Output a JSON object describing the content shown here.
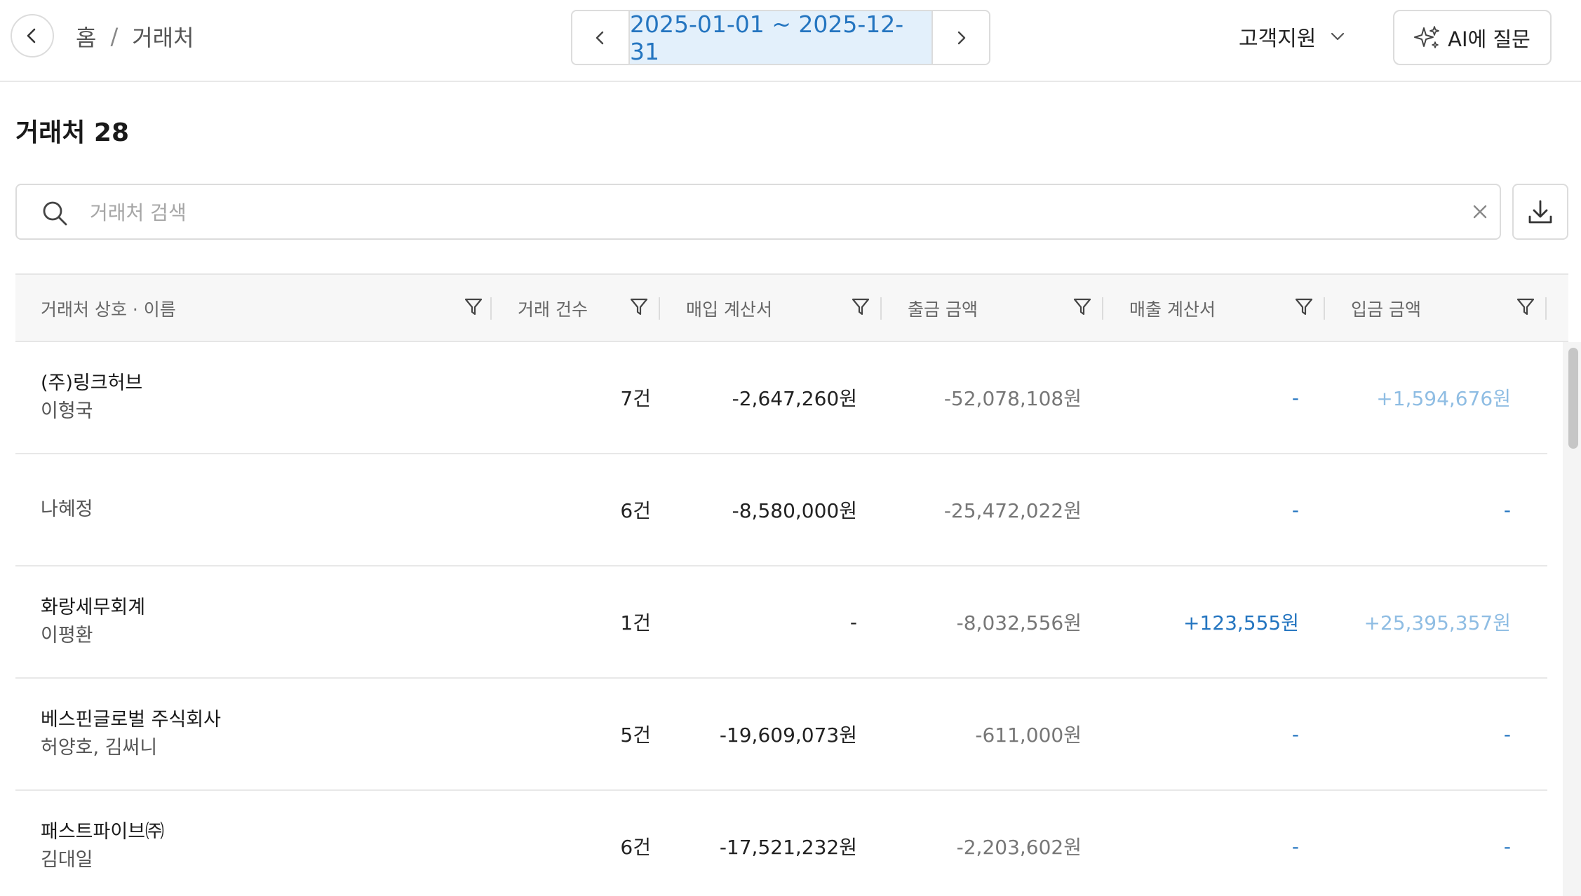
{
  "header": {
    "breadcrumb": {
      "home": "홈",
      "separator": "/",
      "current": "거래처"
    },
    "date_range": "2025-01-01 ~ 2025-12-31",
    "support_label": "고객지원",
    "ai_button_label": "AI에 질문"
  },
  "page": {
    "title": "거래처 28"
  },
  "search": {
    "placeholder": "거래처 검색",
    "value": ""
  },
  "table": {
    "columns": [
      "거래처 상호 · 이름",
      "거래 건수",
      "매입 계산서",
      "출금 금액",
      "매출 계산서",
      "입금 금액"
    ],
    "rows": [
      {
        "company": "(주)링크허브",
        "person": "이형국",
        "count": "7건",
        "purchase_invoice": "-2,647,260원",
        "withdrawal": "-52,078,108원",
        "sales_invoice": "-",
        "deposit": "+1,594,676원"
      },
      {
        "company": "나혜정",
        "person": "",
        "count": "6건",
        "purchase_invoice": "-8,580,000원",
        "withdrawal": "-25,472,022원",
        "sales_invoice": "-",
        "deposit": "-"
      },
      {
        "company": "화랑세무회계",
        "person": "이평환",
        "count": "1건",
        "purchase_invoice": "-",
        "withdrawal": "-8,032,556원",
        "sales_invoice": "+123,555원",
        "deposit": "+25,395,357원"
      },
      {
        "company": "베스핀글로벌 주식회사",
        "person": "허양호, 김써니",
        "count": "5건",
        "purchase_invoice": "-19,609,073원",
        "withdrawal": "-611,000원",
        "sales_invoice": "-",
        "deposit": "-"
      },
      {
        "company": "패스트파이브㈜",
        "person": "김대일",
        "count": "6건",
        "purchase_invoice": "-17,521,232원",
        "withdrawal": "-2,203,602원",
        "sales_invoice": "-",
        "deposit": "-"
      }
    ]
  },
  "colors": {
    "accent_blue": "#2475c0",
    "faded_blue": "#8fbde3",
    "date_bg": "#e3f0fb",
    "border": "#dcdcdc"
  },
  "icons": {
    "back": "chevron-left-icon",
    "prev": "chevron-left-icon",
    "next": "chevron-right-icon",
    "support": "chevron-down-icon",
    "ai": "sparkle-icon",
    "search": "search-icon",
    "clear": "close-icon",
    "download": "download-icon",
    "filter": "filter-icon"
  }
}
